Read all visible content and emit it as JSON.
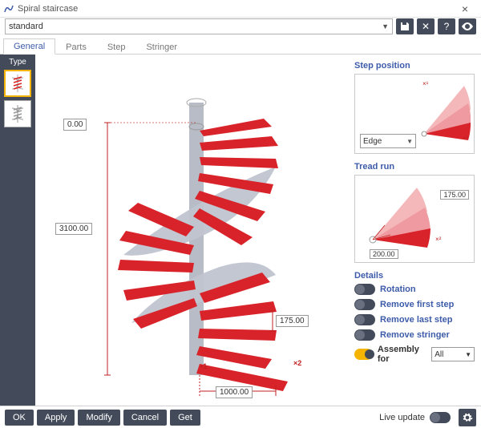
{
  "window": {
    "title": "Spiral staircase"
  },
  "preset": {
    "value": "standard"
  },
  "tabs": [
    "General",
    "Parts",
    "Step",
    "Stringer"
  ],
  "type_label": "Type",
  "dims": {
    "top": "0.00",
    "height": "3100.00",
    "step": "175.00",
    "radius": "1000.00"
  },
  "markers": {
    "one": "1",
    "two": "2"
  },
  "step_position": {
    "title": "Step position",
    "select": "Edge"
  },
  "tread_run": {
    "title": "Tread run",
    "outer": "175.00",
    "inner": "200.00"
  },
  "details": {
    "title": "Details",
    "rotation": "Rotation",
    "remove_first": "Remove first step",
    "remove_last": "Remove last step",
    "remove_stringer": "Remove stringer",
    "assembly_for": "Assembly for",
    "assembly_value": "All"
  },
  "footer": {
    "ok": "OK",
    "apply": "Apply",
    "modify": "Modify",
    "cancel": "Cancel",
    "get": "Get",
    "live_update": "Live update"
  }
}
